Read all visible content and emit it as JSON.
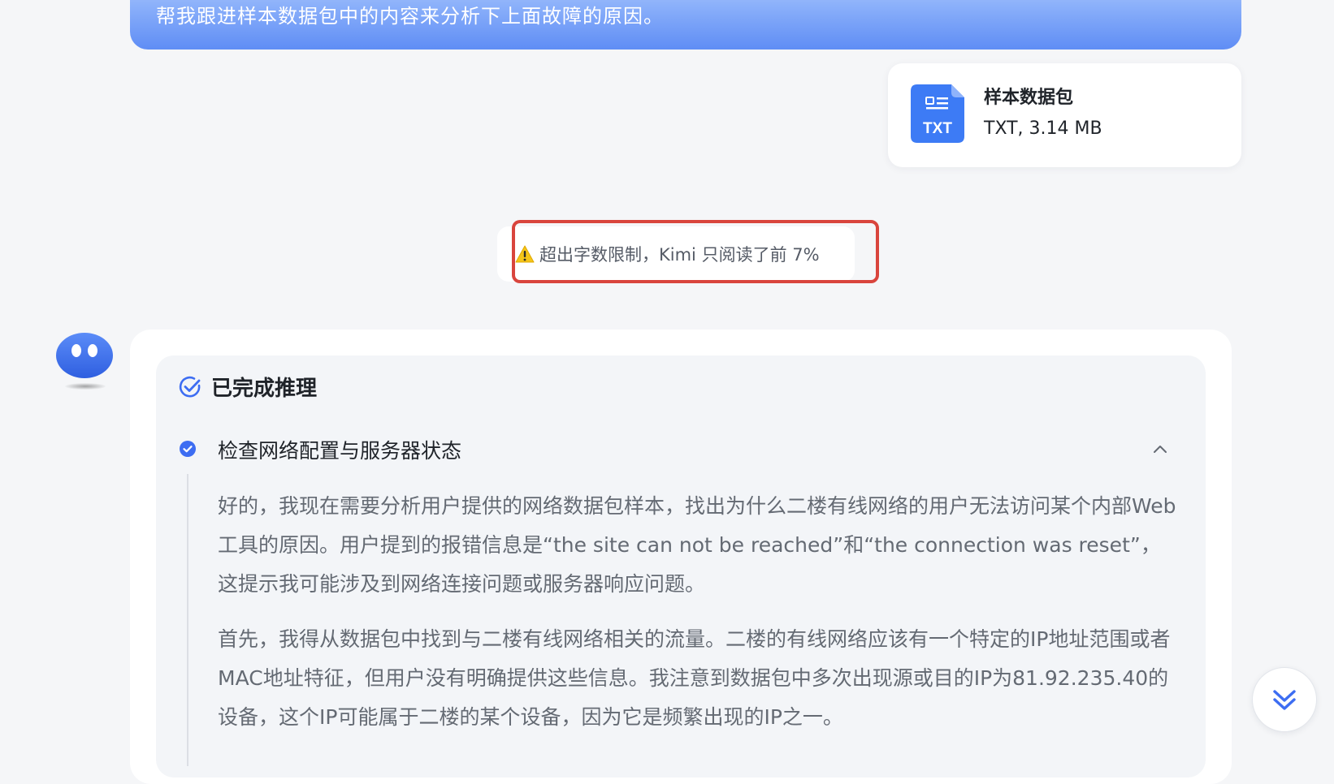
{
  "user_message": {
    "text": "帮我跟进样本数据包中的内容来分析下上面故障的原因。"
  },
  "attachment": {
    "name": "样本数据包",
    "meta": "TXT, 3.14 MB",
    "icon": "txt-file-icon",
    "icon_label": "TXT"
  },
  "notice": {
    "icon": "warning-icon",
    "text": "超出字数限制，Kimi 只阅读了前 7%"
  },
  "assistant": {
    "avatar": "kimi-avatar",
    "reasoning": {
      "title": "已完成推理",
      "steps": [
        {
          "title": "检查网络配置与服务器状态",
          "paragraphs": [
            "好的，我现在需要分析用户提供的网络数据包样本，找出为什么二楼有线网络的用户无法访问某个内部Web工具的原因。用户提到的报错信息是“the site can not be reached”和“the connection was reset”，这提示我可能涉及到网络连接问题或服务器响应问题。",
            "首先，我得从数据包中找到与二楼有线网络相关的流量。二楼的有线网络应该有一个特定的IP地址范围或者MAC地址特征，但用户没有明确提供这些信息。我注意到数据包中多次出现源或目的IP为81.92.235.40的设备，这个IP可能属于二楼的某个设备，因为它是频繁出现的IP之一。"
          ]
        }
      ]
    }
  },
  "colors": {
    "accent": "#3d6df2",
    "warning_border": "#d9453d",
    "warning_icon": "#f5c518"
  }
}
